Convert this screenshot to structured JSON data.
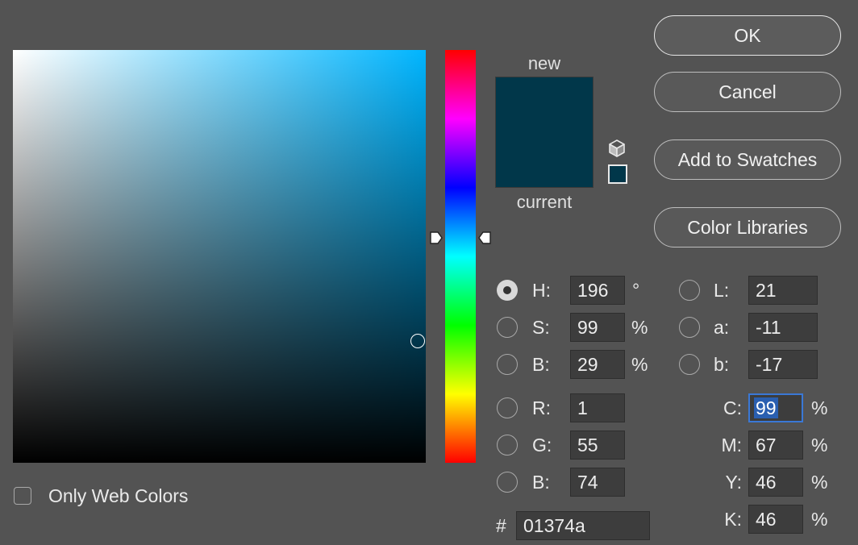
{
  "buttons": {
    "ok": "OK",
    "cancel": "Cancel",
    "add_to_swatches": "Add to Swatches",
    "color_libraries": "Color Libraries"
  },
  "swatch": {
    "new_label": "new",
    "current_label": "current",
    "new_color": "#01374a",
    "current_color": "#01374a"
  },
  "icons": {
    "gamut": "cube-icon"
  },
  "hsb": {
    "h": {
      "label": "H:",
      "value": "196",
      "unit": "°"
    },
    "s": {
      "label": "S:",
      "value": "99",
      "unit": "%"
    },
    "b": {
      "label": "B:",
      "value": "29",
      "unit": "%"
    }
  },
  "rgb": {
    "r": {
      "label": "R:",
      "value": "1"
    },
    "g": {
      "label": "G:",
      "value": "55"
    },
    "b": {
      "label": "B:",
      "value": "74"
    }
  },
  "lab": {
    "l": {
      "label": "L:",
      "value": "21"
    },
    "a": {
      "label": "a:",
      "value": "-11"
    },
    "b": {
      "label": "b:",
      "value": "-17"
    }
  },
  "cmyk": {
    "c": {
      "label": "C:",
      "value": "99",
      "unit": "%"
    },
    "m": {
      "label": "M:",
      "value": "67",
      "unit": "%"
    },
    "y": {
      "label": "Y:",
      "value": "46",
      "unit": "%"
    },
    "k": {
      "label": "K:",
      "value": "46",
      "unit": "%"
    }
  },
  "hex": {
    "label": "#",
    "value": "01374a"
  },
  "only_web_colors": {
    "label": "Only Web Colors",
    "checked": false
  },
  "selected_mode": "H"
}
